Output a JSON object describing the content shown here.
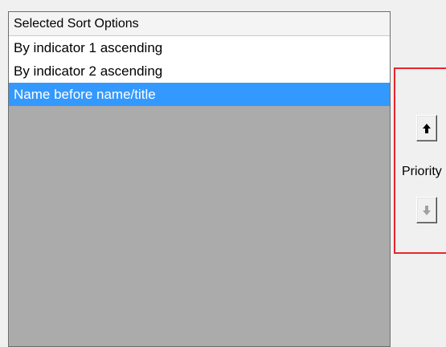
{
  "list": {
    "header": "Selected Sort Options",
    "items": [
      {
        "label": "By indicator 1 ascending",
        "selected": false
      },
      {
        "label": "By indicator 2 ascending",
        "selected": false
      },
      {
        "label": "Name before name/title",
        "selected": true
      }
    ]
  },
  "priority": {
    "label": "Priority",
    "up_icon": "arrow-up-icon",
    "down_icon": "arrow-down-icon",
    "up_enabled": true,
    "down_enabled": false
  },
  "colors": {
    "selection": "#3399ff",
    "highlight_border": "#e8262b",
    "list_empty_area": "#ababab"
  }
}
